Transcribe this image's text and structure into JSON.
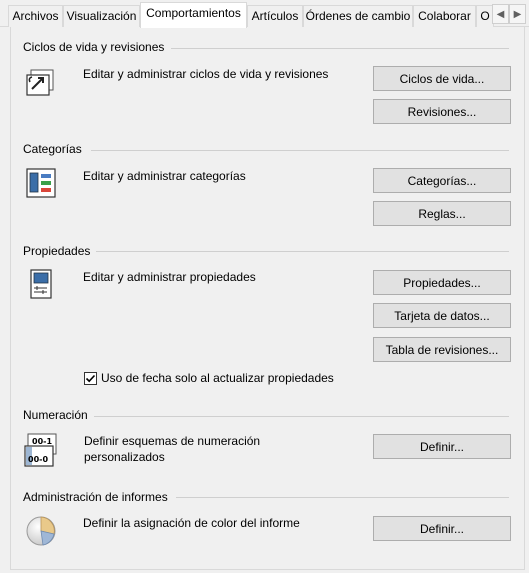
{
  "tabs": [
    {
      "label": "Archivos",
      "active": false
    },
    {
      "label": "Visualización",
      "active": false
    },
    {
      "label": "Comportamientos",
      "active": true
    },
    {
      "label": "Artículos",
      "active": false
    },
    {
      "label": "Órdenes de cambio",
      "active": false
    },
    {
      "label": "Colaborar",
      "active": false
    },
    {
      "label": "O",
      "active": false
    }
  ],
  "groups": {
    "lifecycle": {
      "title": "Ciclos de vida y revisiones",
      "description": "Editar y administrar ciclos de vida y revisiones",
      "buttons": {
        "lifecycles": "Ciclos de vida...",
        "revisions": "Revisiones..."
      }
    },
    "categories": {
      "title": "Categorías",
      "description": "Editar y administrar categorías",
      "buttons": {
        "categories": "Categorías...",
        "rules": "Reglas..."
      }
    },
    "properties": {
      "title": "Propiedades",
      "description": "Editar y administrar propiedades",
      "buttons": {
        "properties": "Propiedades...",
        "datacard": "Tarjeta de datos...",
        "revision_table": "Tabla de revisiones..."
      },
      "checkbox": {
        "label": "Uso de fecha solo al actualizar propiedades",
        "checked": true
      }
    },
    "numbering": {
      "title": "Numeración",
      "description_line1": "Definir esquemas de numeración",
      "description_line2": "personalizados",
      "icon_text_top": "00-1",
      "icon_text_bottom": "00-0",
      "buttons": {
        "define": "Definir..."
      }
    },
    "reports": {
      "title": "Administración de informes",
      "description": "Definir la asignación de color del informe",
      "buttons": {
        "define": "Definir..."
      }
    }
  },
  "colors": {
    "button_bg": "#e1e1e1",
    "button_border": "#adadad",
    "panel_bg": "#f0f0f0"
  }
}
